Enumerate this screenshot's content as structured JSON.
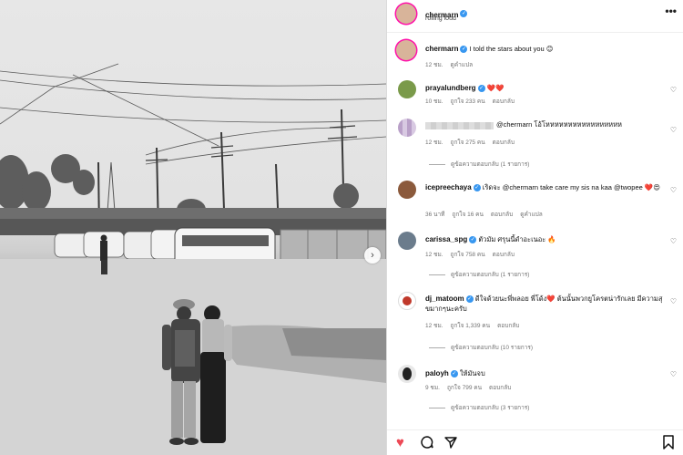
{
  "post": {
    "author": "chermarn",
    "subtitle": "rolling loud",
    "more_label": "•••",
    "next_label": "›"
  },
  "caption": {
    "author": "chermarn",
    "text": "I told the stars about you 😊",
    "time": "12 ชม.",
    "translate": "ดูคำแปล"
  },
  "comments": [
    {
      "user": "prayalundberg",
      "text": "❤️❤️",
      "time": "10 ชม.",
      "likes": "ถูกใจ 233 คน",
      "reply": "ตอบกลับ",
      "extra": "",
      "view_replies": "",
      "avatar_color": "#7a9a4a"
    },
    {
      "user": "",
      "text": "@chermarn โอ้โหหหหหหหหหหหหหหหหห",
      "time": "12 ชม.",
      "likes": "ถูกใจ 275 คน",
      "reply": "ตอบกลับ",
      "extra": "",
      "view_replies": "ดูข้อความตอบกลับ (1 รายการ)",
      "avatar_color": "#b9a0c8"
    },
    {
      "user": "icepreechaya",
      "text": "เริดจะ @chermarn take care my sis na kaa @twopee ❤️😍",
      "time": "36 นาที",
      "likes": "ถูกใจ 16 คน",
      "reply": "ตอบกลับ",
      "extra": "ดูคำแปล",
      "view_replies": "",
      "avatar_color": "#8b5a3c"
    },
    {
      "user": "carissa_spg",
      "text": "ตัวมัม ศรุนนี้ดำอะเนอะ 🔥",
      "time": "12 ชม.",
      "likes": "ถูกใจ 758 คน",
      "reply": "ตอบกลับ",
      "extra": "",
      "view_replies": "ดูข้อความตอบกลับ (1 รายการ)",
      "avatar_color": "#6b7c8c"
    },
    {
      "user": "dj_matoom",
      "text": "ดีใจด้วยนะพี่พลอย พี่โด้ง❤️ ต้นนั้นพวกยูโครตน่ารักเลย มีความสุขมากๆนะครับ",
      "time": "12 ชม.",
      "likes": "ถูกใจ 1,339 คน",
      "reply": "ตอบกลับ",
      "extra": "",
      "view_replies": "ดูข้อความตอบกลับ (10 รายการ)",
      "avatar_color": "#c0392b"
    },
    {
      "user": "paloyh",
      "text": "ให้มันจบ",
      "time": "9 ชม.",
      "likes": "ถูกใจ 799 คน",
      "reply": "ตอบกลับ",
      "extra": "",
      "view_replies": "ดูข้อความตอบกลับ (3 รายการ)",
      "avatar_color": "#222222"
    }
  ],
  "actions": {
    "like_icon": "heart-filled-icon",
    "comment_icon": "comment-icon",
    "share_icon": "share-icon",
    "save_icon": "bookmark-icon"
  },
  "colors": {
    "like": "#ed4956",
    "verified": "#3897f0",
    "accent_ring": "#ff1493"
  }
}
